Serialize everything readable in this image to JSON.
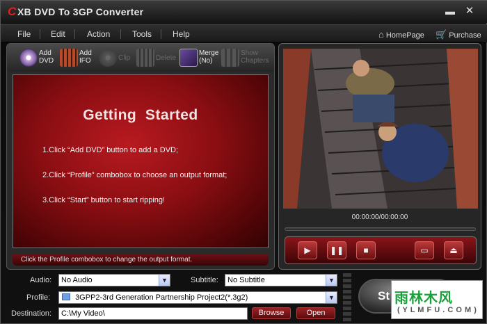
{
  "app": {
    "logo_letter": "C",
    "title": "XB DVD To 3GP Converter",
    "min_glyph": "▬",
    "close_glyph": "✕"
  },
  "menu": {
    "items": [
      "File",
      "Edit",
      "Action",
      "Tools",
      "Help"
    ],
    "homepage": "HomePage",
    "purchase": "Purchase"
  },
  "toolbar": {
    "add_dvd": "Add\nDVD",
    "add_ifo": "Add\nIFO",
    "clip": "Clip",
    "delete": "Delete",
    "merge": "Merge\n(No)",
    "show_chapters": "Show\nChapters"
  },
  "getting_started": {
    "title": "Getting  Started",
    "step1": "1.Click “Add DVD” button to add a DVD;",
    "step2": "2.Click “Profile” combobox to choose an output format;",
    "step3": "3.Click “Start” button to start ripping!"
  },
  "status": "Click the Profile combobox to change the output format.",
  "player": {
    "time": "00:00:00/00:00:00"
  },
  "settings": {
    "audio_label": "Audio:",
    "audio_value": "No Audio",
    "subtitle_label": "Subtitle:",
    "subtitle_value": "No Subtitle",
    "profile_label": "Profile:",
    "profile_value": "3GPP2-3rd Generation Partnership Project2(*.3g2)",
    "destination_label": "Destination:",
    "destination_value": "C:\\My Video\\",
    "browse": "Browse",
    "open": "Open"
  },
  "start": "St",
  "watermark": {
    "cn": "雨林木风",
    "url": "( Y L M F U . C O M )"
  },
  "colors": {
    "accent_red": "#b81a20",
    "bg": "#111111"
  }
}
